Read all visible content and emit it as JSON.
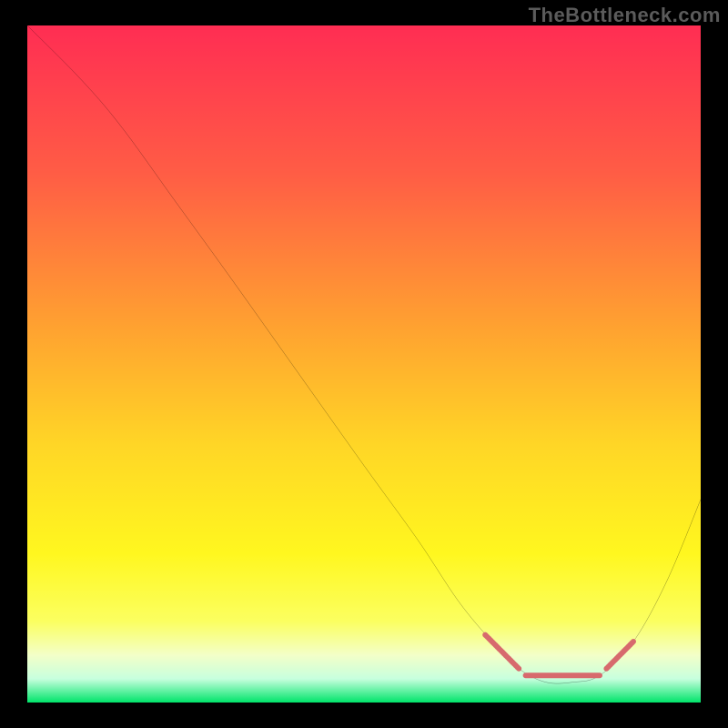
{
  "watermark": "TheBottleneck.com",
  "chart_data": {
    "type": "line",
    "title": "",
    "xlabel": "",
    "ylabel": "",
    "xlim": [
      0,
      100
    ],
    "ylim": [
      0,
      100
    ],
    "grid": false,
    "legend": null,
    "background_gradient": {
      "stops": [
        {
          "offset": 0.0,
          "color": "#ff2d53"
        },
        {
          "offset": 0.22,
          "color": "#ff5d45"
        },
        {
          "offset": 0.45,
          "color": "#ffa330"
        },
        {
          "offset": 0.62,
          "color": "#ffd626"
        },
        {
          "offset": 0.78,
          "color": "#fff71f"
        },
        {
          "offset": 0.88,
          "color": "#fbff60"
        },
        {
          "offset": 0.93,
          "color": "#f3ffc8"
        },
        {
          "offset": 0.965,
          "color": "#c7ffde"
        },
        {
          "offset": 1.0,
          "color": "#00e46a"
        }
      ]
    },
    "series": [
      {
        "name": "curve",
        "stroke": "#000000",
        "stroke_width": 1.6,
        "points": [
          {
            "x": 0,
            "y": 100
          },
          {
            "x": 8,
            "y": 92
          },
          {
            "x": 14,
            "y": 85
          },
          {
            "x": 22,
            "y": 74
          },
          {
            "x": 30,
            "y": 63
          },
          {
            "x": 40,
            "y": 49
          },
          {
            "x": 50,
            "y": 35
          },
          {
            "x": 58,
            "y": 24
          },
          {
            "x": 64,
            "y": 15
          },
          {
            "x": 69,
            "y": 9
          },
          {
            "x": 73,
            "y": 5
          },
          {
            "x": 77,
            "y": 3
          },
          {
            "x": 81,
            "y": 3
          },
          {
            "x": 85,
            "y": 4
          },
          {
            "x": 90,
            "y": 9
          },
          {
            "x": 95,
            "y": 18
          },
          {
            "x": 100,
            "y": 30
          }
        ]
      },
      {
        "name": "marker-band",
        "stroke": "#d76a6d",
        "stroke_width": 6,
        "segments": [
          {
            "x1": 68,
            "y1": 10,
            "x2": 73,
            "y2": 5
          },
          {
            "x1": 74,
            "y1": 4,
            "x2": 85,
            "y2": 4
          },
          {
            "x1": 86,
            "y1": 5,
            "x2": 90,
            "y2": 9
          }
        ]
      }
    ]
  }
}
